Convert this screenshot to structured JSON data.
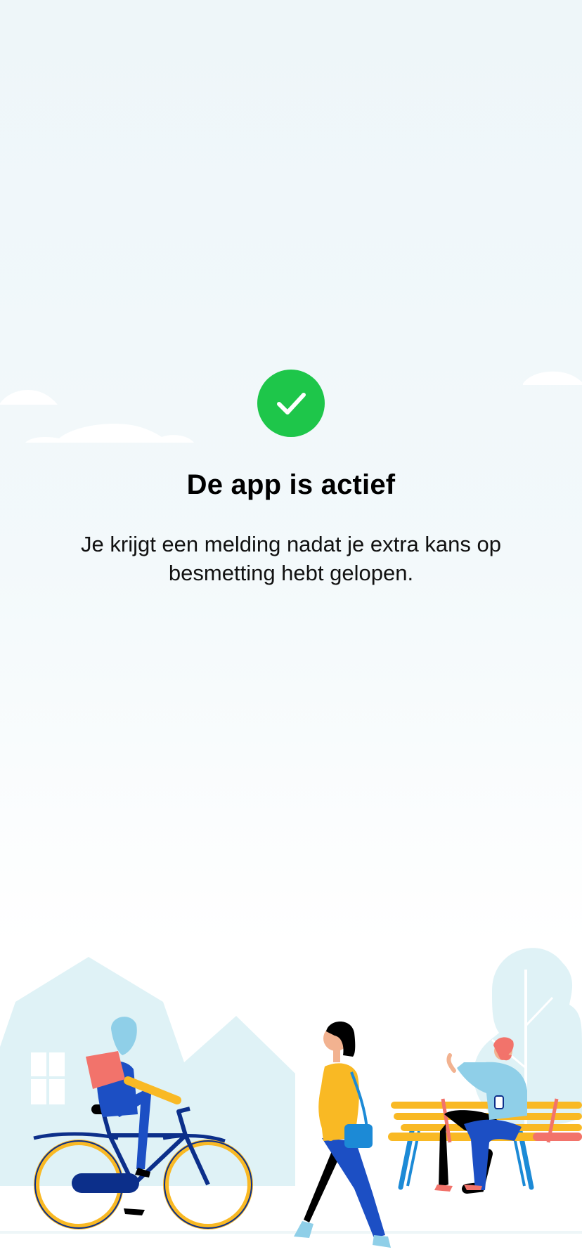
{
  "status": {
    "icon": "checkmark-icon",
    "color": "#1ec64a",
    "title": "De app is actief",
    "description": "Je krijgt een melding nadat je extra kans op besmetting hebt gelopen."
  },
  "illustration": {
    "name": "city-scene-illustration",
    "figures": [
      "cyclist",
      "walking-woman",
      "man-on-bench"
    ],
    "colors": {
      "background_shapes": "#dff2f6",
      "accent_yellow": "#f9b924",
      "dark_blue": "#0c2f8a",
      "mid_blue": "#1c4fc4"
    }
  }
}
